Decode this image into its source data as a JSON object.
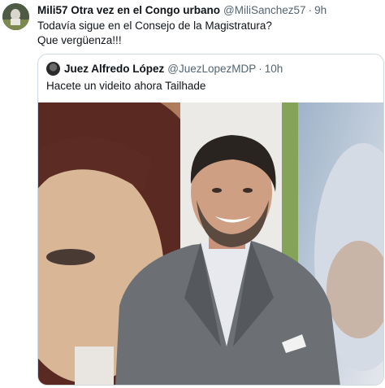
{
  "tweet": {
    "author_name": "Mili57 Otra vez en el Congo urbano",
    "handle": "@MiliSanchez57",
    "separator": "·",
    "time": "9h",
    "text_line1": "Todavía sigue en el Consejo de la Magistratura?",
    "text_line2": "Que vergüenza!!!"
  },
  "quoted": {
    "author_name": "Juez Alfredo López",
    "handle": "@JuezLopezMDP",
    "separator": "·",
    "time": "10h",
    "text": "Hacete un videito ahora Tailhade"
  },
  "colors": {
    "text_primary": "#0f1419",
    "text_secondary": "#536471",
    "border": "#cfd9de"
  }
}
